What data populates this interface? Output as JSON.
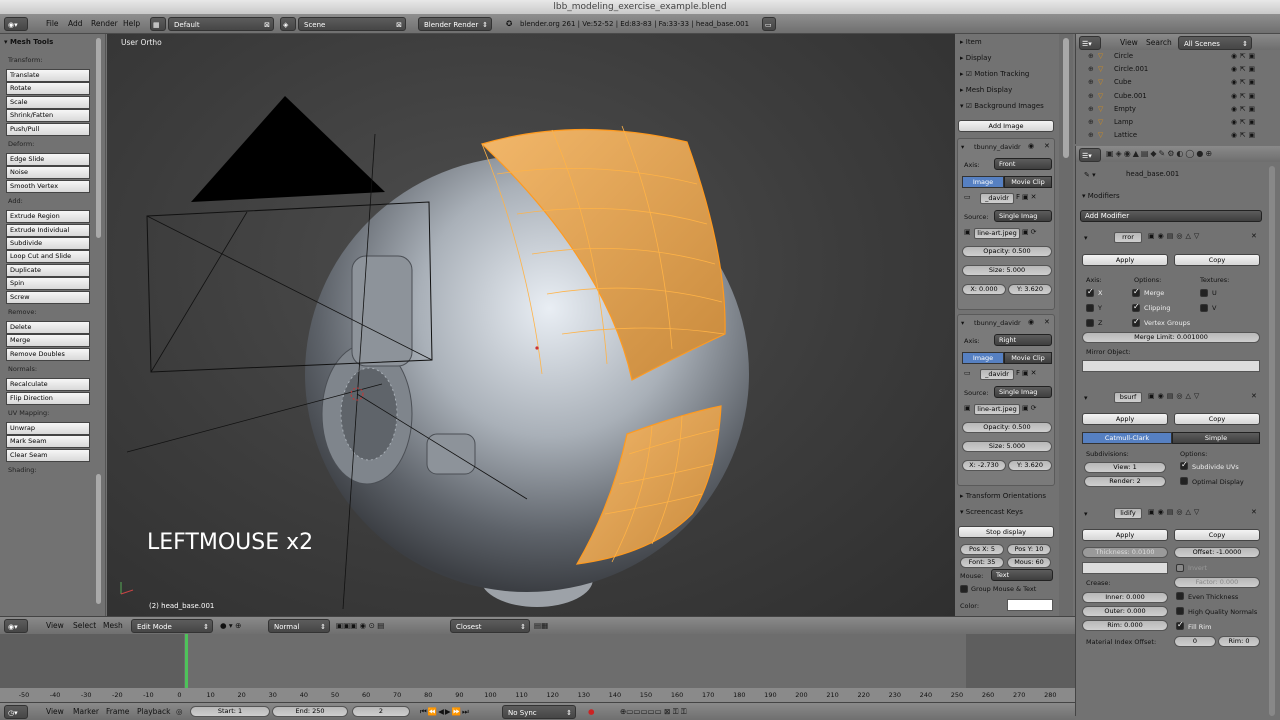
{
  "window_title": "lbb_modeling_exercise_example.blend",
  "topbar": {
    "menus": [
      "File",
      "Add",
      "Render",
      "Help"
    ],
    "layout": "Default",
    "scene": "Scene",
    "engine": "Blender Render",
    "stats": "blender.org 261 | Ve:52-52 | Ed:83-83 | Fa:33-33 | head_base.001"
  },
  "toolshelf": {
    "title": "Mesh Tools",
    "sections": [
      {
        "label": "Transform:",
        "buttons": [
          "Translate",
          "Rotate",
          "Scale",
          "Shrink/Fatten",
          "Push/Pull"
        ]
      },
      {
        "label": "Deform:",
        "buttons": [
          "Edge Slide",
          "Noise",
          "Smooth Vertex"
        ]
      },
      {
        "label": "Add:",
        "buttons": [
          "Extrude Region",
          "Extrude Individual",
          "Subdivide",
          "Loop Cut and Slide",
          "Duplicate",
          "Spin",
          "Screw"
        ]
      },
      {
        "label": "Remove:",
        "buttons": [
          "Delete",
          "Merge",
          "Remove Doubles"
        ]
      },
      {
        "label": "Normals:",
        "buttons": [
          "Recalculate",
          "Flip Direction"
        ]
      },
      {
        "label": "UV Mapping:",
        "buttons": [
          "Unwrap",
          "Mark Seam",
          "Clear Seam"
        ]
      },
      {
        "label": "Shading:",
        "buttons": []
      }
    ]
  },
  "viewport": {
    "view_label": "User Ortho",
    "overlay_text": "LEFTMOUSE x2",
    "object_label": "(2) head_base.001"
  },
  "ntab": {
    "item": "Item",
    "display": "Display",
    "motion_tracking": "Motion Tracking",
    "mesh_display": "Mesh Display",
    "background_images": "Background Images",
    "add_image": "Add Image",
    "images": [
      {
        "name": "tbunny_davidr",
        "axis_label": "Axis:",
        "axis": "Front",
        "tab_image": "Image",
        "tab_clip": "Movie Clip",
        "img_name": "_davidr",
        "source_label": "Source:",
        "source": "Single Imag",
        "file": "line-art.jpeg",
        "opacity": "Opacity: 0.500",
        "size": "Size: 5.000",
        "x": "X: 0.000",
        "y": "Y: 3.620"
      },
      {
        "name": "tbunny_davidr",
        "axis_label": "Axis:",
        "axis": "Right",
        "tab_image": "Image",
        "tab_clip": "Movie Clip",
        "img_name": "_davidr",
        "source_label": "Source:",
        "source": "Single Imag",
        "file": "line-art.jpeg",
        "opacity": "Opacity: 0.500",
        "size": "Size: 5.000",
        "x": "X: -2.730",
        "y": "Y: 3.620"
      }
    ],
    "transform_orientations": "Transform Orientations",
    "screencast_keys": "Screencast Keys",
    "stop_display": "Stop display",
    "pos_x": "Pos X: 5",
    "pos_y": "Pos Y: 10",
    "font": "Font: 35",
    "mous": "Mous: 60",
    "mouse_label": "Mouse:",
    "mouse_value": "Text",
    "group_mouse": "Group Mouse & Text",
    "color_label": "Color:"
  },
  "outliner": {
    "view": "View",
    "search": "Search",
    "all_scenes": "All Scenes",
    "items": [
      "Circle",
      "Circle.001",
      "Cube",
      "Cube.001",
      "Empty",
      "Lamp",
      "Lattice"
    ]
  },
  "properties": {
    "object": "head_base.001",
    "modifiers": "Modifiers",
    "add_modifier": "Add Modifier",
    "mirror": {
      "name": "rror",
      "apply": "Apply",
      "copy": "Copy",
      "axis": "Axis:",
      "options": "Options:",
      "textures": "Textures:",
      "x": "X",
      "y": "Y",
      "z": "Z",
      "merge": "Merge",
      "clipping": "Clipping",
      "vgroups": "Vertex Groups",
      "u": "U",
      "v": "V",
      "merge_limit": "Merge Limit: 0.001000",
      "mirror_object": "Mirror Object:"
    },
    "subsurf": {
      "name": "bsurf",
      "apply": "Apply",
      "copy": "Copy",
      "catmull": "Catmull-Clark",
      "simple": "Simple",
      "subdivisions": "Subdivisions:",
      "options": "Options:",
      "view": "View: 1",
      "render": "Render: 2",
      "subdivide_uvs": "Subdivide UVs",
      "optimal": "Optimal Display"
    },
    "solidify": {
      "name": "lidify",
      "apply": "Apply",
      "copy": "Copy",
      "thickness": "Thickness: 0.0100",
      "offset": "Offset: -1.0000",
      "invert": "Invert",
      "factor": "Factor: 0.000",
      "crease": "Crease:",
      "inner": "Inner: 0.000",
      "outer": "Outer: 0.000",
      "rim": "Rim: 0.000",
      "even": "Even Thickness",
      "hq": "High Quality Normals",
      "fill_rim": "Fill Rim",
      "mat_index": "Material Index Offset:",
      "mat_val": "0",
      "rim_val": "Rim: 0"
    }
  },
  "view3d_header": {
    "menus": [
      "View",
      "Select",
      "Mesh"
    ],
    "mode": "Edit Mode",
    "pivot": "Normal",
    "snap": "Closest"
  },
  "timeline": {
    "ticks": [
      "-50",
      "-40",
      "-30",
      "-20",
      "-10",
      "0",
      "10",
      "20",
      "30",
      "40",
      "50",
      "60",
      "70",
      "80",
      "90",
      "100",
      "110",
      "120",
      "130",
      "140",
      "150",
      "160",
      "170",
      "180",
      "190",
      "200",
      "210",
      "220",
      "230",
      "240",
      "250",
      "260",
      "270",
      "280"
    ],
    "menus": [
      "View",
      "Marker",
      "Frame",
      "Playback"
    ],
    "start": "Start: 1",
    "end": "End: 250",
    "current": "2",
    "sync": "No Sync"
  }
}
